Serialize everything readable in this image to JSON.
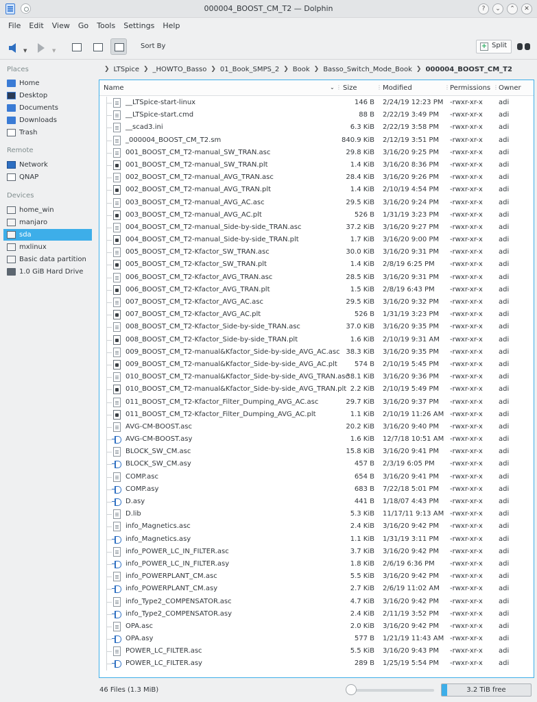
{
  "window": {
    "title": "000004_BOOST_CM_T2 — Dolphin"
  },
  "menu": [
    "File",
    "Edit",
    "View",
    "Go",
    "Tools",
    "Settings",
    "Help"
  ],
  "toolbar": {
    "sort_by": "Sort By",
    "split": "Split"
  },
  "sidebar": {
    "places_header": "Places",
    "places": [
      "Home",
      "Desktop",
      "Documents",
      "Downloads",
      "Trash"
    ],
    "remote_header": "Remote",
    "remote": [
      "Network",
      "QNAP"
    ],
    "devices_header": "Devices",
    "devices": [
      "home_win",
      "manjaro",
      "sda",
      "mxlinux",
      "Basic data partition",
      "1.0 GiB Hard Drive"
    ],
    "selected": "sda"
  },
  "breadcrumb": [
    "LTSpice",
    "_HOWTO_Basso",
    "01_Book_SMPS_2",
    "Book",
    "Basso_Switch_Mode_Book",
    "000004_BOOST_CM_T2"
  ],
  "columns": {
    "name": "Name",
    "size": "Size",
    "modified": "Modified",
    "permissions": "Permissions",
    "owner": "Owner"
  },
  "files": [
    {
      "name": "__LTSpice-start-linux",
      "size": "146 B",
      "modified": "2/24/19 12:23 PM",
      "perm": "-rwxr-xr-x",
      "owner": "adi",
      "type": "doc"
    },
    {
      "name": "__LTSpice-start.cmd",
      "size": "88 B",
      "modified": "2/22/19 3:49 PM",
      "perm": "-rwxr-xr-x",
      "owner": "adi",
      "type": "doc"
    },
    {
      "name": "__scad3.ini",
      "size": "6.3 KiB",
      "modified": "2/22/19 3:58 PM",
      "perm": "-rwxr-xr-x",
      "owner": "adi",
      "type": "doc"
    },
    {
      "name": "_000004_BOOST_CM_T2.sm",
      "size": "840.9 KiB",
      "modified": "2/12/19 3:51 PM",
      "perm": "-rwxr-xr-x",
      "owner": "adi",
      "type": "doc"
    },
    {
      "name": "001_BOOST_CM_T2-manual_SW_TRAN.asc",
      "size": "29.8 KiB",
      "modified": "3/16/20 9:25 PM",
      "perm": "-rwxr-xr-x",
      "owner": "adi",
      "type": "doc"
    },
    {
      "name": "001_BOOST_CM_T2-manual_SW_TRAN.plt",
      "size": "1.4 KiB",
      "modified": "3/16/20 8:36 PM",
      "perm": "-rwxr-xr-x",
      "owner": "adi",
      "type": "plt"
    },
    {
      "name": "002_BOOST_CM_T2-manual_AVG_TRAN.asc",
      "size": "28.4 KiB",
      "modified": "3/16/20 9:26 PM",
      "perm": "-rwxr-xr-x",
      "owner": "adi",
      "type": "doc"
    },
    {
      "name": "002_BOOST_CM_T2-manual_AVG_TRAN.plt",
      "size": "1.4 KiB",
      "modified": "2/10/19 4:54 PM",
      "perm": "-rwxr-xr-x",
      "owner": "adi",
      "type": "plt"
    },
    {
      "name": "003_BOOST_CM_T2-manual_AVG_AC.asc",
      "size": "29.5 KiB",
      "modified": "3/16/20 9:24 PM",
      "perm": "-rwxr-xr-x",
      "owner": "adi",
      "type": "doc"
    },
    {
      "name": "003_BOOST_CM_T2-manual_AVG_AC.plt",
      "size": "526 B",
      "modified": "1/31/19 3:23 PM",
      "perm": "-rwxr-xr-x",
      "owner": "adi",
      "type": "plt"
    },
    {
      "name": "004_BOOST_CM_T2-manual_Side-by-side_TRAN.asc",
      "size": "37.2 KiB",
      "modified": "3/16/20 9:27 PM",
      "perm": "-rwxr-xr-x",
      "owner": "adi",
      "type": "doc"
    },
    {
      "name": "004_BOOST_CM_T2-manual_Side-by-side_TRAN.plt",
      "size": "1.7 KiB",
      "modified": "3/16/20 9:00 PM",
      "perm": "-rwxr-xr-x",
      "owner": "adi",
      "type": "plt"
    },
    {
      "name": "005_BOOST_CM_T2-Kfactor_SW_TRAN.asc",
      "size": "30.0 KiB",
      "modified": "3/16/20 9:31 PM",
      "perm": "-rwxr-xr-x",
      "owner": "adi",
      "type": "doc"
    },
    {
      "name": "005_BOOST_CM_T2-Kfactor_SW_TRAN.plt",
      "size": "1.4 KiB",
      "modified": "2/8/19 6:25 PM",
      "perm": "-rwxr-xr-x",
      "owner": "adi",
      "type": "plt"
    },
    {
      "name": "006_BOOST_CM_T2-Kfactor_AVG_TRAN.asc",
      "size": "28.5 KiB",
      "modified": "3/16/20 9:31 PM",
      "perm": "-rwxr-xr-x",
      "owner": "adi",
      "type": "doc"
    },
    {
      "name": "006_BOOST_CM_T2-Kfactor_AVG_TRAN.plt",
      "size": "1.5 KiB",
      "modified": "2/8/19 6:43 PM",
      "perm": "-rwxr-xr-x",
      "owner": "adi",
      "type": "plt"
    },
    {
      "name": "007_BOOST_CM_T2-Kfactor_AVG_AC.asc",
      "size": "29.5 KiB",
      "modified": "3/16/20 9:32 PM",
      "perm": "-rwxr-xr-x",
      "owner": "adi",
      "type": "doc"
    },
    {
      "name": "007_BOOST_CM_T2-Kfactor_AVG_AC.plt",
      "size": "526 B",
      "modified": "1/31/19 3:23 PM",
      "perm": "-rwxr-xr-x",
      "owner": "adi",
      "type": "plt"
    },
    {
      "name": "008_BOOST_CM_T2-Kfactor_Side-by-side_TRAN.asc",
      "size": "37.0 KiB",
      "modified": "3/16/20 9:35 PM",
      "perm": "-rwxr-xr-x",
      "owner": "adi",
      "type": "doc"
    },
    {
      "name": "008_BOOST_CM_T2-Kfactor_Side-by-side_TRAN.plt",
      "size": "1.6 KiB",
      "modified": "2/10/19 9:31 AM",
      "perm": "-rwxr-xr-x",
      "owner": "adi",
      "type": "plt"
    },
    {
      "name": "009_BOOST_CM_T2-manual&Kfactor_Side-by-side_AVG_AC.asc",
      "size": "38.3 KiB",
      "modified": "3/16/20 9:35 PM",
      "perm": "-rwxr-xr-x",
      "owner": "adi",
      "type": "doc"
    },
    {
      "name": "009_BOOST_CM_T2-manual&Kfactor_Side-by-side_AVG_AC.plt",
      "size": "574 B",
      "modified": "2/10/19 5:45 PM",
      "perm": "-rwxr-xr-x",
      "owner": "adi",
      "type": "plt"
    },
    {
      "name": "010_BOOST_CM_T2-manual&Kfactor_Side-by-side_AVG_TRAN.asc",
      "size": "38.1 KiB",
      "modified": "3/16/20 9:36 PM",
      "perm": "-rwxr-xr-x",
      "owner": "adi",
      "type": "doc"
    },
    {
      "name": "010_BOOST_CM_T2-manual&Kfactor_Side-by-side_AVG_TRAN.plt",
      "size": "2.2 KiB",
      "modified": "2/10/19 5:49 PM",
      "perm": "-rwxr-xr-x",
      "owner": "adi",
      "type": "plt"
    },
    {
      "name": "011_BOOST_CM_T2-Kfactor_Filter_Dumping_AVG_AC.asc",
      "size": "29.7 KiB",
      "modified": "3/16/20 9:37 PM",
      "perm": "-rwxr-xr-x",
      "owner": "adi",
      "type": "doc"
    },
    {
      "name": "011_BOOST_CM_T2-Kfactor_Filter_Dumping_AVG_AC.plt",
      "size": "1.1 KiB",
      "modified": "2/10/19 11:26 AM",
      "perm": "-rwxr-xr-x",
      "owner": "adi",
      "type": "plt"
    },
    {
      "name": "AVG-CM-BOOST.asc",
      "size": "20.2 KiB",
      "modified": "3/16/20 9:40 PM",
      "perm": "-rwxr-xr-x",
      "owner": "adi",
      "type": "doc"
    },
    {
      "name": "AVG-CM-BOOST.asy",
      "size": "1.6 KiB",
      "modified": "12/7/18 10:51 AM",
      "perm": "-rwxr-xr-x",
      "owner": "adi",
      "type": "asy"
    },
    {
      "name": "BLOCK_SW_CM.asc",
      "size": "15.8 KiB",
      "modified": "3/16/20 9:41 PM",
      "perm": "-rwxr-xr-x",
      "owner": "adi",
      "type": "doc"
    },
    {
      "name": "BLOCK_SW_CM.asy",
      "size": "457 B",
      "modified": "2/3/19 6:05 PM",
      "perm": "-rwxr-xr-x",
      "owner": "adi",
      "type": "asy"
    },
    {
      "name": "COMP.asc",
      "size": "654 B",
      "modified": "3/16/20 9:41 PM",
      "perm": "-rwxr-xr-x",
      "owner": "adi",
      "type": "doc"
    },
    {
      "name": "COMP.asy",
      "size": "683 B",
      "modified": "7/22/18 5:01 PM",
      "perm": "-rwxr-xr-x",
      "owner": "adi",
      "type": "asy"
    },
    {
      "name": "D.asy",
      "size": "441 B",
      "modified": "1/18/07 4:43 PM",
      "perm": "-rwxr-xr-x",
      "owner": "adi",
      "type": "asy"
    },
    {
      "name": "D.lib",
      "size": "5.3 KiB",
      "modified": "11/17/11 9:13 AM",
      "perm": "-rwxr-xr-x",
      "owner": "adi",
      "type": "doc"
    },
    {
      "name": "info_Magnetics.asc",
      "size": "2.4 KiB",
      "modified": "3/16/20 9:42 PM",
      "perm": "-rwxr-xr-x",
      "owner": "adi",
      "type": "doc"
    },
    {
      "name": "info_Magnetics.asy",
      "size": "1.1 KiB",
      "modified": "1/31/19 3:11 PM",
      "perm": "-rwxr-xr-x",
      "owner": "adi",
      "type": "asy"
    },
    {
      "name": "info_POWER_LC_IN_FILTER.asc",
      "size": "3.7 KiB",
      "modified": "3/16/20 9:42 PM",
      "perm": "-rwxr-xr-x",
      "owner": "adi",
      "type": "doc"
    },
    {
      "name": "info_POWER_LC_IN_FILTER.asy",
      "size": "1.8 KiB",
      "modified": "2/6/19 6:36 PM",
      "perm": "-rwxr-xr-x",
      "owner": "adi",
      "type": "asy"
    },
    {
      "name": "info_POWERPLANT_CM.asc",
      "size": "5.5 KiB",
      "modified": "3/16/20 9:42 PM",
      "perm": "-rwxr-xr-x",
      "owner": "adi",
      "type": "doc"
    },
    {
      "name": "info_POWERPLANT_CM.asy",
      "size": "2.7 KiB",
      "modified": "2/6/19 11:02 AM",
      "perm": "-rwxr-xr-x",
      "owner": "adi",
      "type": "asy"
    },
    {
      "name": "info_Type2_COMPENSATOR.asc",
      "size": "4.7 KiB",
      "modified": "3/16/20 9:42 PM",
      "perm": "-rwxr-xr-x",
      "owner": "adi",
      "type": "doc"
    },
    {
      "name": "info_Type2_COMPENSATOR.asy",
      "size": "2.4 KiB",
      "modified": "2/11/19 3:52 PM",
      "perm": "-rwxr-xr-x",
      "owner": "adi",
      "type": "asy"
    },
    {
      "name": "OPA.asc",
      "size": "2.0 KiB",
      "modified": "3/16/20 9:42 PM",
      "perm": "-rwxr-xr-x",
      "owner": "adi",
      "type": "doc"
    },
    {
      "name": "OPA.asy",
      "size": "577 B",
      "modified": "1/21/19 11:43 AM",
      "perm": "-rwxr-xr-x",
      "owner": "adi",
      "type": "asy"
    },
    {
      "name": "POWER_LC_FILTER.asc",
      "size": "5.5 KiB",
      "modified": "3/16/20 9:43 PM",
      "perm": "-rwxr-xr-x",
      "owner": "adi",
      "type": "doc"
    },
    {
      "name": "POWER_LC_FILTER.asy",
      "size": "289 B",
      "modified": "1/25/19 5:54 PM",
      "perm": "-rwxr-xr-x",
      "owner": "adi",
      "type": "asy"
    }
  ],
  "status": {
    "summary": "46 Files (1.3 MiB)",
    "free_space": "3.2 TiB free",
    "used_fraction": 0.06
  },
  "colors": {
    "accent": "#3daee9",
    "selection": "#3daee9"
  }
}
